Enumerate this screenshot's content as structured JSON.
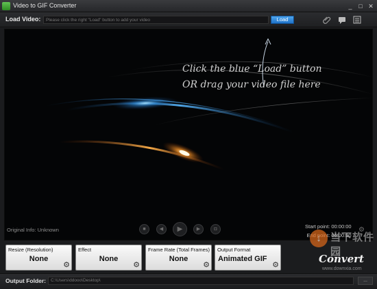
{
  "window": {
    "title": "Video to GIF Converter",
    "controls": {
      "minimize": "_",
      "maximize": "□",
      "close": "✕"
    }
  },
  "load": {
    "label": "Load Video:",
    "placeholder": "Please click the right \"Load\" button to add your video",
    "button_label": "Load",
    "tool_icons": [
      "paperclip-icon",
      "comment-icon",
      "list-icon"
    ]
  },
  "preview": {
    "hint_line1": "Click the blue “Load” button",
    "hint_line2": "OR drag your video file here",
    "original_info": "Original Info: Unknown",
    "controls": [
      "stop",
      "previous",
      "play",
      "next",
      "screenshot"
    ],
    "start_point": "Start point: 00:00:00",
    "end_point": "End point: 00:00:00"
  },
  "settings": [
    {
      "label": "Resize (Resolution)",
      "value": "None"
    },
    {
      "label": "Effect",
      "value": "None"
    },
    {
      "label": "Frame Rate (Total Frames)",
      "value": "None"
    },
    {
      "label": "Output Format",
      "value": "Animated GIF"
    }
  ],
  "convert": {
    "label": "Convert"
  },
  "output": {
    "label": "Output Folder:",
    "path": "C:\\Users\\ddooo\\Desktop\\",
    "browse_label": "..."
  },
  "watermark": {
    "text": "当下软件园",
    "url": "www.downxia.com"
  },
  "colors": {
    "accent": "#2a86de",
    "background": "#1b1c1e",
    "panel": "#f0f0f0"
  }
}
